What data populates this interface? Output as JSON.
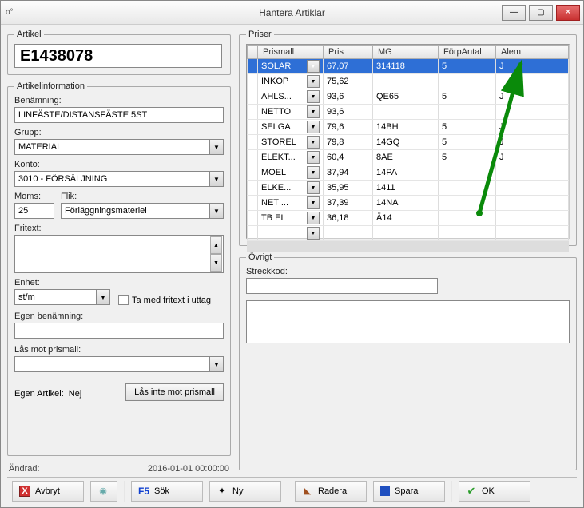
{
  "window": {
    "title": "Hantera Artiklar"
  },
  "artikel": {
    "legend": "Artikel",
    "number": "E1438078"
  },
  "artikelinfo": {
    "legend": "Artikelinformation",
    "benamning_label": "Benämning:",
    "benamning": "LINFÄSTE/DISTANSFÄSTE 5ST",
    "grupp_label": "Grupp:",
    "grupp": "MATERIAL",
    "konto_label": "Konto:",
    "konto": "3010 - FÖRSÄLJNING",
    "moms_label": "Moms:",
    "moms": "25",
    "flik_label": "Flik:",
    "flik": "Förläggningsmateriel",
    "fritext_label": "Fritext:",
    "enhet_label": "Enhet:",
    "enhet": "st/m",
    "ta_med_label": "Ta med fritext i uttag",
    "egen_ben_label": "Egen benämning:",
    "las_label": "Lås mot prismall:",
    "egen_artikel_label": "Egen Artikel:",
    "egen_artikel_val": "Nej",
    "las_btn": "Lås inte mot prismall"
  },
  "priser": {
    "legend": "Priser",
    "cols": [
      "Prismall",
      "Pris",
      "MG",
      "FörpAntal",
      "Alem"
    ],
    "rows": [
      {
        "prismall": "SOLAR",
        "pris": "67,07",
        "mg": "314118",
        "forp": "5",
        "alem": "J",
        "selected": true
      },
      {
        "prismall": "INKOP",
        "pris": "75,62",
        "mg": "",
        "forp": "",
        "alem": ""
      },
      {
        "prismall": "AHLS...",
        "pris": "93,6",
        "mg": "QE65",
        "forp": "5",
        "alem": "J"
      },
      {
        "prismall": "NETTO",
        "pris": "93,6",
        "mg": "",
        "forp": "",
        "alem": ""
      },
      {
        "prismall": "SELGA",
        "pris": "79,6",
        "mg": "14BH",
        "forp": "5",
        "alem": "J"
      },
      {
        "prismall": "STOREL",
        "pris": "79,8",
        "mg": "14GQ",
        "forp": "5",
        "alem": "J"
      },
      {
        "prismall": "ELEKT...",
        "pris": "60,4",
        "mg": "8AE",
        "forp": "5",
        "alem": "J"
      },
      {
        "prismall": "MOEL",
        "pris": "37,94",
        "mg": "14PA",
        "forp": "",
        "alem": ""
      },
      {
        "prismall": "ELKE...",
        "pris": "35,95",
        "mg": "1411",
        "forp": "",
        "alem": ""
      },
      {
        "prismall": "NET ...",
        "pris": "37,39",
        "mg": "14NA",
        "forp": "",
        "alem": ""
      },
      {
        "prismall": "TB EL",
        "pris": "36,18",
        "mg": "Ä14",
        "forp": "",
        "alem": ""
      },
      {
        "prismall": "",
        "pris": "",
        "mg": "",
        "forp": "",
        "alem": ""
      }
    ]
  },
  "ovrigt": {
    "legend": "Övrigt",
    "streckkod_label": "Streckkod:"
  },
  "changed": {
    "label": "Ändrad:",
    "value": "2016-01-01 00:00:00"
  },
  "toolbar": {
    "avbryt": "Avbryt",
    "sok": "Sök",
    "ny": "Ny",
    "radera": "Radera",
    "spara": "Spara",
    "ok": "OK",
    "f5": "F5"
  }
}
